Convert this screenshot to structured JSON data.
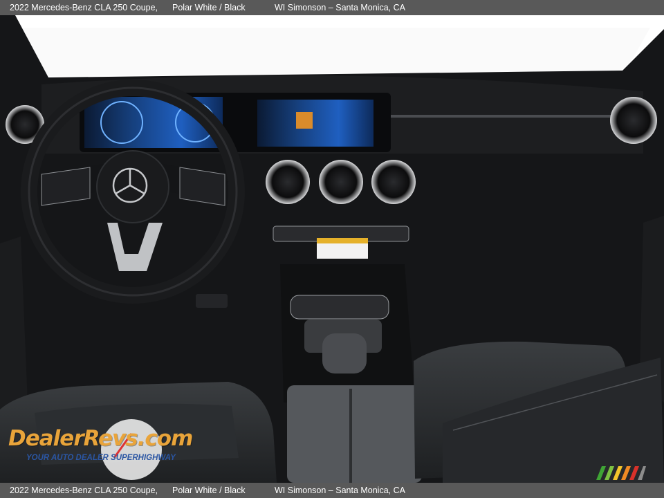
{
  "caption": {
    "vehicle": "2022 Mercedes-Benz CLA 250 Coupe,",
    "color": "Polar White / Black",
    "dealer": "WI Simonson – Santa Monica, CA"
  },
  "watermark": {
    "logo": "DealerRevs.com",
    "tagline": "YOUR AUTO DEALER SUPERHIGHWAY"
  },
  "colors": {
    "caption_bar": "#595959",
    "caption_text": "#ffffff",
    "dashboard": "#151618",
    "screen_blue": "#1f5fc0",
    "watermark_orange": "#e9a43a",
    "watermark_blue": "#2b56a3"
  }
}
